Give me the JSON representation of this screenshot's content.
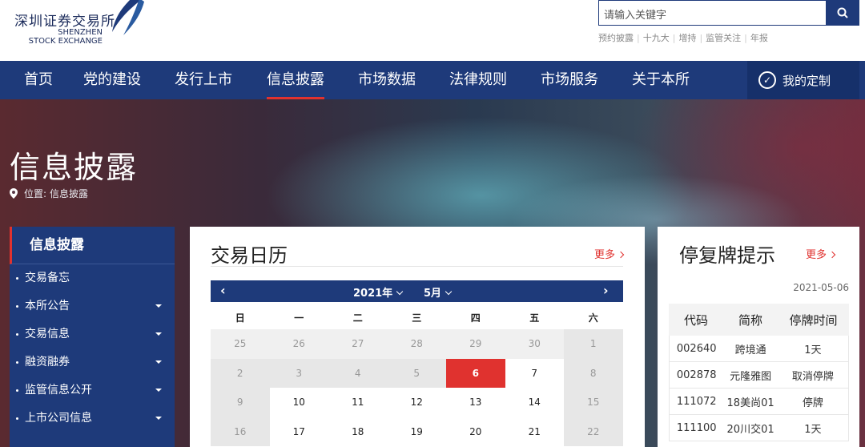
{
  "header": {
    "logo_cn": "深圳证券交易所",
    "logo_en_line1": "SHENZHEN",
    "logo_en_line2": "STOCK EXCHANGE",
    "search_placeholder": "请输入关键字",
    "quick_links": [
      "预约披露",
      "十九大",
      "增持",
      "监管关注",
      "年报"
    ]
  },
  "nav": {
    "items": [
      "首页",
      "党的建设",
      "发行上市",
      "信息披露",
      "市场数据",
      "法律规则",
      "市场服务",
      "关于本所"
    ],
    "active": "信息披露",
    "custom": "我的定制"
  },
  "banner": {
    "title": "信息披露",
    "crumb_prefix": "位置:",
    "crumb_current": "信息披露"
  },
  "sidebar": {
    "heading": "信息披露",
    "items": [
      {
        "label": "交易备忘",
        "has_sub": false
      },
      {
        "label": "本所公告",
        "has_sub": true
      },
      {
        "label": "交易信息",
        "has_sub": true
      },
      {
        "label": "融资融券",
        "has_sub": true
      },
      {
        "label": "监管信息公开",
        "has_sub": true
      },
      {
        "label": "上市公司信息",
        "has_sub": true
      }
    ]
  },
  "calendar": {
    "title": "交易日历",
    "more": "更多",
    "year": "2021年",
    "month": "5月",
    "weekdays": [
      "日",
      "一",
      "二",
      "三",
      "四",
      "五",
      "六"
    ],
    "weeks": [
      [
        {
          "d": "25",
          "t": "other"
        },
        {
          "d": "26",
          "t": "other"
        },
        {
          "d": "27",
          "t": "other"
        },
        {
          "d": "28",
          "t": "other"
        },
        {
          "d": "29",
          "t": "other"
        },
        {
          "d": "30",
          "t": "other"
        },
        {
          "d": "1",
          "t": "off"
        }
      ],
      [
        {
          "d": "2",
          "t": "off"
        },
        {
          "d": "3",
          "t": "off"
        },
        {
          "d": "4",
          "t": "off"
        },
        {
          "d": "5",
          "t": "off"
        },
        {
          "d": "6",
          "t": "today"
        },
        {
          "d": "7",
          "t": "normal"
        },
        {
          "d": "8",
          "t": "off"
        }
      ],
      [
        {
          "d": "9",
          "t": "off"
        },
        {
          "d": "10",
          "t": "normal"
        },
        {
          "d": "11",
          "t": "normal"
        },
        {
          "d": "12",
          "t": "normal"
        },
        {
          "d": "13",
          "t": "normal"
        },
        {
          "d": "14",
          "t": "normal"
        },
        {
          "d": "15",
          "t": "off"
        }
      ],
      [
        {
          "d": "16",
          "t": "off"
        },
        {
          "d": "17",
          "t": "normal"
        },
        {
          "d": "18",
          "t": "normal"
        },
        {
          "d": "19",
          "t": "normal"
        },
        {
          "d": "20",
          "t": "normal"
        },
        {
          "d": "21",
          "t": "normal"
        },
        {
          "d": "22",
          "t": "off"
        }
      ]
    ]
  },
  "suspension": {
    "title": "停复牌提示",
    "more": "更多",
    "date": "2021-05-06",
    "columns": [
      "代码",
      "简称",
      "停牌时间"
    ],
    "rows": [
      [
        "002640",
        "跨境通",
        "1天"
      ],
      [
        "002878",
        "元隆雅图",
        "取消停牌"
      ],
      [
        "111072",
        "18美尚01",
        "停牌"
      ],
      [
        "111100",
        "20川交01",
        "1天"
      ]
    ]
  },
  "colors": {
    "primary": "#1e3a7a",
    "accent": "#e0322f"
  }
}
